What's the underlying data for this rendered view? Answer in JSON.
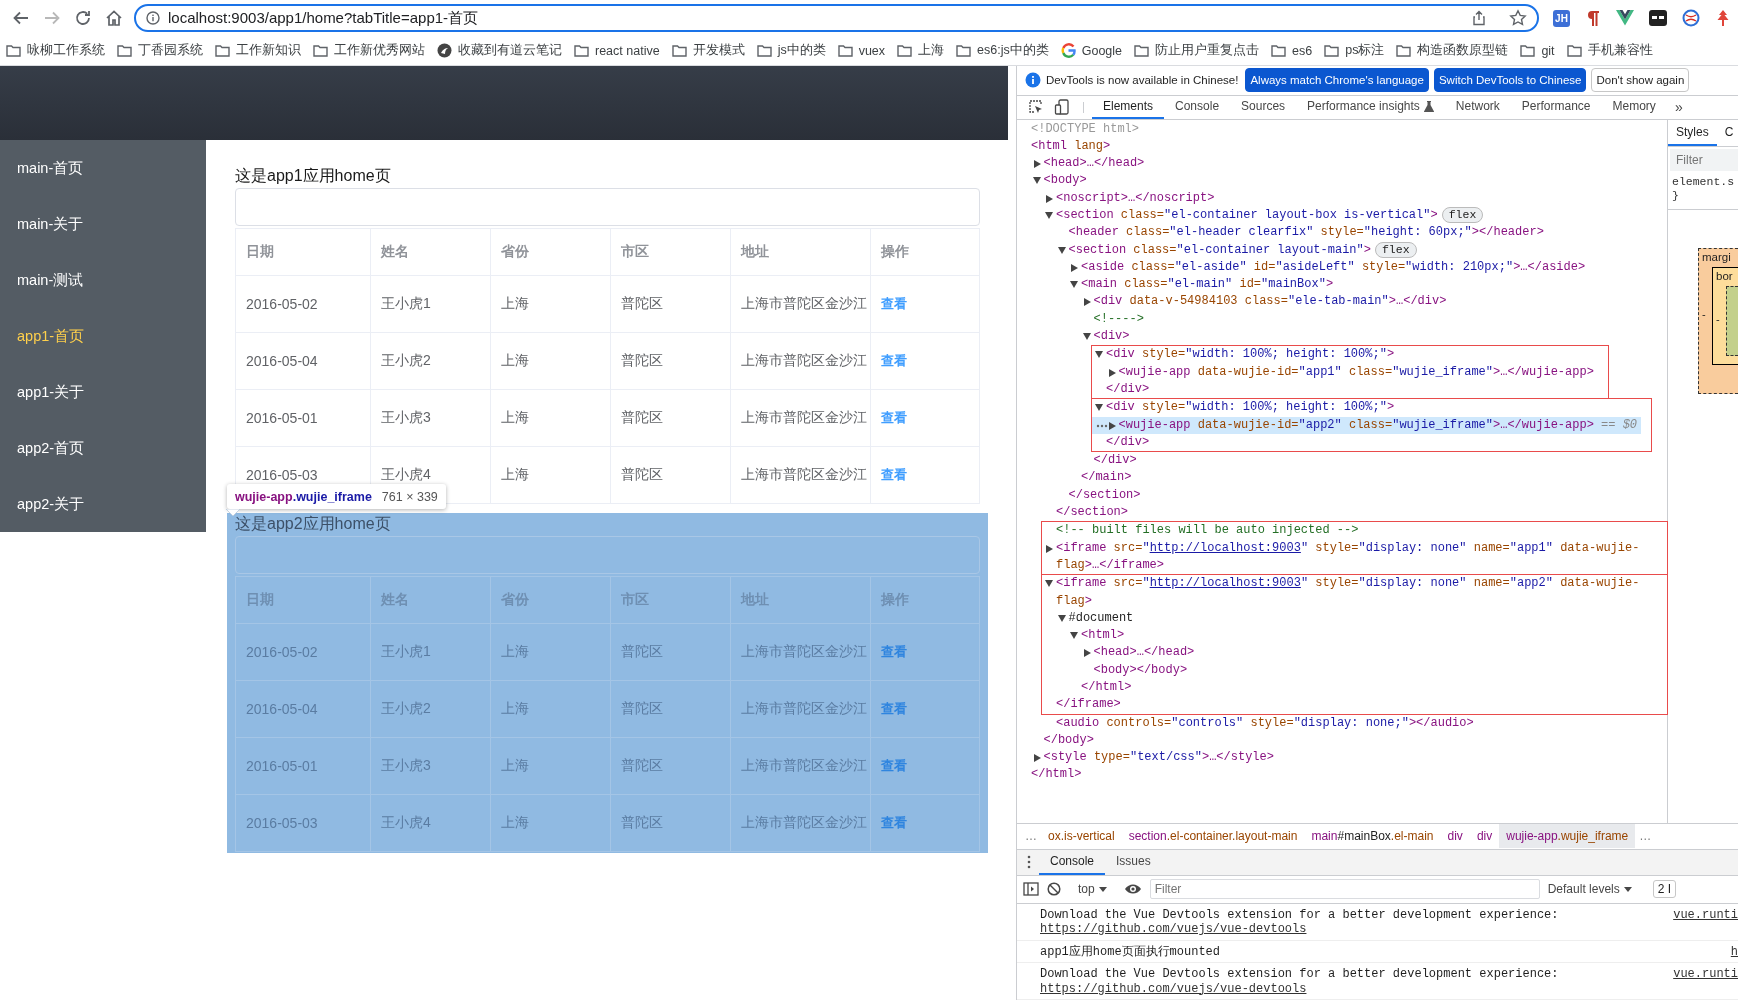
{
  "browser": {
    "nav": [
      {
        "kind": "back",
        "disabled": false
      },
      {
        "kind": "forward",
        "disabled": true
      },
      {
        "kind": "reload",
        "disabled": false
      },
      {
        "kind": "home",
        "disabled": false
      }
    ],
    "url": "localhost:9003/app1/home?tabTitle=app1-首页",
    "extensions": [
      {
        "kind": "badge",
        "text": "JH"
      },
      {
        "kind": "pilcrow"
      },
      {
        "kind": "vue"
      },
      {
        "kind": "mask"
      },
      {
        "kind": "globe"
      },
      {
        "kind": "tree"
      }
    ],
    "bookmarks": [
      {
        "kind": "folder",
        "label": "咏柳工作系统"
      },
      {
        "kind": "folder",
        "label": "丁香园系统"
      },
      {
        "kind": "folder",
        "label": "工作新知识"
      },
      {
        "kind": "folder",
        "label": "工作新优秀网站"
      },
      {
        "kind": "site",
        "label": "收藏到有道云笔记"
      },
      {
        "kind": "folder",
        "label": "react native"
      },
      {
        "kind": "folder",
        "label": "开发模式"
      },
      {
        "kind": "folder",
        "label": "js中的类"
      },
      {
        "kind": "folder",
        "label": "vuex"
      },
      {
        "kind": "folder",
        "label": "上海"
      },
      {
        "kind": "folder",
        "label": "es6:js中的类"
      },
      {
        "kind": "google",
        "label": "Google"
      },
      {
        "kind": "folder",
        "label": "防止用户重复点击"
      },
      {
        "kind": "folder",
        "label": "es6"
      },
      {
        "kind": "folder",
        "label": "ps标注"
      },
      {
        "kind": "folder",
        "label": "构造函数原型链"
      },
      {
        "kind": "folder",
        "label": "git"
      },
      {
        "kind": "folder",
        "label": "手机兼容性"
      }
    ]
  },
  "page": {
    "menu": [
      {
        "label": "main-首页",
        "selected": false
      },
      {
        "label": "main-关于",
        "selected": false
      },
      {
        "label": "main-测试",
        "selected": false
      },
      {
        "label": "app1-首页",
        "selected": true
      },
      {
        "label": "app1-关于",
        "selected": false
      },
      {
        "label": "app2-首页",
        "selected": false
      },
      {
        "label": "app2-关于",
        "selected": false
      }
    ],
    "frames": [
      {
        "title": "这是app1应用home页",
        "inspected": false,
        "columns": [
          "日期",
          "姓名",
          "省份",
          "市区",
          "地址",
          "操作"
        ],
        "rows": [
          {
            "date": "2016-05-02",
            "name": "王小虎1",
            "province": "上海",
            "city": "普陀区",
            "address": "上海市普陀区金沙江",
            "action": "查看"
          },
          {
            "date": "2016-05-04",
            "name": "王小虎2",
            "province": "上海",
            "city": "普陀区",
            "address": "上海市普陀区金沙江",
            "action": "查看"
          },
          {
            "date": "2016-05-01",
            "name": "王小虎3",
            "province": "上海",
            "city": "普陀区",
            "address": "上海市普陀区金沙江",
            "action": "查看"
          },
          {
            "date": "2016-05-03",
            "name": "王小虎4",
            "province": "上海",
            "city": "普陀区",
            "address": "上海市普陀区金沙江",
            "action": "查看"
          }
        ]
      },
      {
        "title": "这是app2应用home页",
        "inspected": true,
        "columns": [
          "日期",
          "姓名",
          "省份",
          "市区",
          "地址",
          "操作"
        ],
        "rows": [
          {
            "date": "2016-05-02",
            "name": "王小虎1",
            "province": "上海",
            "city": "普陀区",
            "address": "上海市普陀区金沙江",
            "action": "查看"
          },
          {
            "date": "2016-05-04",
            "name": "王小虎2",
            "province": "上海",
            "city": "普陀区",
            "address": "上海市普陀区金沙江",
            "action": "查看"
          },
          {
            "date": "2016-05-01",
            "name": "王小虎3",
            "province": "上海",
            "city": "普陀区",
            "address": "上海市普陀区金沙江",
            "action": "查看"
          },
          {
            "date": "2016-05-03",
            "name": "王小虎4",
            "province": "上海",
            "city": "普陀区",
            "address": "上海市普陀区金沙江",
            "action": "查看"
          }
        ]
      }
    ],
    "tooltip": {
      "tag": "wujie-app",
      "cls": ".wujie_iframe",
      "size": "761 × 339"
    }
  },
  "devtools": {
    "infobar": {
      "message": "DevTools is now available in Chinese!",
      "buttons": [
        {
          "label": "Always match Chrome's language",
          "kind": "primary"
        },
        {
          "label": "Switch DevTools to Chinese",
          "kind": "primary"
        },
        {
          "label": "Don't show again",
          "kind": "secondary"
        }
      ]
    },
    "tabs": [
      {
        "label": "Elements",
        "selected": true,
        "kind": "plain"
      },
      {
        "label": "Console",
        "selected": false,
        "kind": "plain"
      },
      {
        "label": "Sources",
        "selected": false,
        "kind": "plain"
      },
      {
        "label": "Performance insights",
        "selected": false,
        "kind": "experiment"
      },
      {
        "label": "Network",
        "selected": false,
        "kind": "plain"
      },
      {
        "label": "Performance",
        "selected": false,
        "kind": "plain"
      },
      {
        "label": "Memory",
        "selected": false,
        "kind": "plain"
      }
    ],
    "more_tabs": "»",
    "tree": [
      {
        "kind": "element",
        "selected": false,
        "line": [
          {
            "kind": "doctype",
            "text": "<!DOCTYPE html>"
          }
        ]
      },
      {
        "kind": "element",
        "selected": false,
        "line": [
          {
            "kind": "tag",
            "text": "<html"
          },
          {
            "kind": "attr",
            "text": " lang"
          },
          {
            "kind": "tag",
            "text": ">"
          }
        ],
        "close": [
          {
            "kind": "tag",
            "text": "</html>"
          }
        ],
        "children": [
          {
            "kind": "element",
            "selected": false,
            "expanded": false,
            "line": [
              {
                "kind": "tag",
                "text": "<head>…</head>"
              }
            ]
          },
          {
            "kind": "element",
            "selected": false,
            "expanded": true,
            "line": [
              {
                "kind": "tag",
                "text": "<body>"
              }
            ],
            "close": [
              {
                "kind": "tag",
                "text": "</body>"
              }
            ],
            "children": [
              {
                "kind": "element",
                "selected": false,
                "expanded": false,
                "line": [
                  {
                    "kind": "tag",
                    "text": "<noscript>…</noscript>"
                  }
                ]
              },
              {
                "kind": "element",
                "selected": false,
                "expanded": true,
                "line": [
                  {
                    "kind": "tag",
                    "text": "<section"
                  },
                  {
                    "kind": "attr",
                    "text": " class="
                  },
                  {
                    "kind": "value",
                    "text": "\"el-container layout-box is-vertical\""
                  },
                  {
                    "kind": "tag",
                    "text": ">"
                  },
                  {
                    "kind": "badge",
                    "text": "flex"
                  }
                ],
                "close": [
                  {
                    "kind": "tag",
                    "text": "</section>"
                  }
                ],
                "children": [
                  {
                    "kind": "element",
                    "selected": false,
                    "line": [
                      {
                        "kind": "tag",
                        "text": "<header"
                      },
                      {
                        "kind": "attr",
                        "text": " class="
                      },
                      {
                        "kind": "value",
                        "text": "\"el-header clearfix\""
                      },
                      {
                        "kind": "attr",
                        "text": " style="
                      },
                      {
                        "kind": "value",
                        "text": "\"height: 60px;\""
                      },
                      {
                        "kind": "tag",
                        "text": "></header>"
                      }
                    ]
                  },
                  {
                    "kind": "element",
                    "selected": false,
                    "expanded": true,
                    "line": [
                      {
                        "kind": "tag",
                        "text": "<section"
                      },
                      {
                        "kind": "attr",
                        "text": " class="
                      },
                      {
                        "kind": "value",
                        "text": "\"el-container layout-main\""
                      },
                      {
                        "kind": "tag",
                        "text": ">"
                      },
                      {
                        "kind": "badge",
                        "text": "flex"
                      }
                    ],
                    "close": [
                      {
                        "kind": "tag",
                        "text": "</section>"
                      }
                    ],
                    "children": [
                      {
                        "kind": "element",
                        "selected": false,
                        "expanded": false,
                        "line": [
                          {
                            "kind": "tag",
                            "text": "<aside"
                          },
                          {
                            "kind": "attr",
                            "text": " class="
                          },
                          {
                            "kind": "value",
                            "text": "\"el-aside\""
                          },
                          {
                            "kind": "attr",
                            "text": " id="
                          },
                          {
                            "kind": "value",
                            "text": "\"asideLeft\""
                          },
                          {
                            "kind": "attr",
                            "text": " style="
                          },
                          {
                            "kind": "value",
                            "text": "\"width: 210px;\""
                          },
                          {
                            "kind": "tag",
                            "text": ">…</aside>"
                          }
                        ]
                      },
                      {
                        "kind": "element",
                        "selected": false,
                        "expanded": true,
                        "line": [
                          {
                            "kind": "tag",
                            "text": "<main"
                          },
                          {
                            "kind": "attr",
                            "text": " class="
                          },
                          {
                            "kind": "value",
                            "text": "\"el-main\""
                          },
                          {
                            "kind": "attr",
                            "text": " id="
                          },
                          {
                            "kind": "value",
                            "text": "\"mainBox\""
                          },
                          {
                            "kind": "tag",
                            "text": ">"
                          }
                        ],
                        "close": [
                          {
                            "kind": "tag",
                            "text": "</main>"
                          }
                        ],
                        "children": [
                          {
                            "kind": "element",
                            "selected": false,
                            "expanded": false,
                            "line": [
                              {
                                "kind": "tag",
                                "text": "<div"
                              },
                              {
                                "kind": "attr",
                                "text": " data-v-54984103 class="
                              },
                              {
                                "kind": "value",
                                "text": "\"ele-tab-main\""
                              },
                              {
                                "kind": "tag",
                                "text": ">…</div>"
                              }
                            ]
                          },
                          {
                            "kind": "element",
                            "selected": false,
                            "line": [
                              {
                                "kind": "comment",
                                "text": "<!---->"
                              }
                            ]
                          },
                          {
                            "kind": "element",
                            "selected": false,
                            "expanded": true,
                            "line": [
                              {
                                "kind": "tag",
                                "text": "<div>"
                              }
                            ],
                            "close": [
                              {
                                "kind": "tag",
                                "text": "</div>"
                              }
                            ],
                            "children": [
                              {
                                "kind": "box",
                                "children": [
                                  {
                                    "kind": "element",
                                    "selected": false,
                                    "expanded": true,
                                    "line": [
                                      {
                                        "kind": "tag",
                                        "text": "<div"
                                      },
                                      {
                                        "kind": "attr",
                                        "text": " style="
                                      },
                                      {
                                        "kind": "value",
                                        "text": "\"width: 100%; height: 100%;\""
                                      },
                                      {
                                        "kind": "tag",
                                        "text": ">"
                                      }
                                    ],
                                    "close": [
                                      {
                                        "kind": "tag",
                                        "text": "</div>"
                                      }
                                    ],
                                    "children": [
                                      {
                                        "kind": "element",
                                        "selected": false,
                                        "expanded": false,
                                        "line": [
                                          {
                                            "kind": "tag",
                                            "text": "<wujie-app"
                                          },
                                          {
                                            "kind": "attr",
                                            "text": " data-wujie-id="
                                          },
                                          {
                                            "kind": "value",
                                            "text": "\"app1\""
                                          },
                                          {
                                            "kind": "attr",
                                            "text": " class="
                                          },
                                          {
                                            "kind": "value",
                                            "text": "\"wujie_iframe\""
                                          },
                                          {
                                            "kind": "tag",
                                            "text": ">…</wujie-app>"
                                          }
                                        ]
                                      }
                                    ]
                                  }
                                ]
                              },
                              {
                                "kind": "box",
                                "children": [
                                  {
                                    "kind": "element",
                                    "selected": false,
                                    "expanded": true,
                                    "line": [
                                      {
                                        "kind": "tag",
                                        "text": "<div"
                                      },
                                      {
                                        "kind": "attr",
                                        "text": " style="
                                      },
                                      {
                                        "kind": "value",
                                        "text": "\"width: 100%; height: 100%;\""
                                      },
                                      {
                                        "kind": "tag",
                                        "text": ">"
                                      }
                                    ],
                                    "close": [
                                      {
                                        "kind": "tag",
                                        "text": "</div>"
                                      }
                                    ],
                                    "children": [
                                      {
                                        "kind": "element",
                                        "selected": true,
                                        "expanded": false,
                                        "line": [
                                          {
                                            "kind": "tag",
                                            "text": "<wujie-app"
                                          },
                                          {
                                            "kind": "attr",
                                            "text": " data-wujie-id="
                                          },
                                          {
                                            "kind": "value",
                                            "text": "\"app2\""
                                          },
                                          {
                                            "kind": "attr",
                                            "text": " class="
                                          },
                                          {
                                            "kind": "value",
                                            "text": "\"wujie_iframe\""
                                          },
                                          {
                                            "kind": "tag",
                                            "text": ">…</wujie-app>"
                                          },
                                          {
                                            "kind": "ref",
                                            "text": " == $0"
                                          }
                                        ]
                                      }
                                    ]
                                  }
                                ]
                              }
                            ]
                          }
                        ]
                      }
                    ]
                  }
                ]
              },
              {
                "kind": "box",
                "children": [
                  {
                    "kind": "element",
                    "selected": false,
                    "line": [
                      {
                        "kind": "comment",
                        "text": "<!-- built files will be auto injected -->"
                      }
                    ]
                  },
                  {
                    "kind": "element",
                    "selected": false,
                    "expanded": false,
                    "line": [
                      {
                        "kind": "tag",
                        "text": "<iframe"
                      },
                      {
                        "kind": "attr",
                        "text": " src="
                      },
                      {
                        "kind": "value",
                        "text": "\""
                      },
                      {
                        "kind": "link",
                        "text": "http://localhost:9003"
                      },
                      {
                        "kind": "value",
                        "text": "\""
                      },
                      {
                        "kind": "attr",
                        "text": " style="
                      },
                      {
                        "kind": "value",
                        "text": "\"display: none\""
                      },
                      {
                        "kind": "attr",
                        "text": " name="
                      },
                      {
                        "kind": "value",
                        "text": "\"app1\""
                      },
                      {
                        "kind": "attr",
                        "text": " data-wujie-flag"
                      },
                      {
                        "kind": "tag",
                        "text": ">…</iframe>"
                      }
                    ]
                  }
                ]
              },
              {
                "kind": "box",
                "children": [
                  {
                    "kind": "element",
                    "selected": false,
                    "expanded": true,
                    "line": [
                      {
                        "kind": "tag",
                        "text": "<iframe"
                      },
                      {
                        "kind": "attr",
                        "text": " src="
                      },
                      {
                        "kind": "value",
                        "text": "\""
                      },
                      {
                        "kind": "link",
                        "text": "http://localhost:9003"
                      },
                      {
                        "kind": "value",
                        "text": "\""
                      },
                      {
                        "kind": "attr",
                        "text": " style="
                      },
                      {
                        "kind": "value",
                        "text": "\"display: none\""
                      },
                      {
                        "kind": "attr",
                        "text": " name="
                      },
                      {
                        "kind": "value",
                        "text": "\"app2\""
                      },
                      {
                        "kind": "attr",
                        "text": " data-wujie-flag"
                      },
                      {
                        "kind": "tag",
                        "text": ">"
                      }
                    ],
                    "close": [
                      {
                        "kind": "tag",
                        "text": "</iframe>"
                      }
                    ],
                    "children": [
                      {
                        "kind": "element",
                        "selected": false,
                        "expanded": true,
                        "line": [
                          {
                            "kind": "plain",
                            "text": "#document"
                          }
                        ],
                        "children": [
                          {
                            "kind": "element",
                            "selected": false,
                            "expanded": true,
                            "line": [
                              {
                                "kind": "tag",
                                "text": "<html>"
                              }
                            ],
                            "close": [
                              {
                                "kind": "tag",
                                "text": "</html>"
                              }
                            ],
                            "children": [
                              {
                                "kind": "element",
                                "selected": false,
                                "expanded": false,
                                "line": [
                                  {
                                    "kind": "tag",
                                    "text": "<head>…</head>"
                                  }
                                ]
                              },
                              {
                                "kind": "element",
                                "selected": false,
                                "line": [
                                  {
                                    "kind": "tag",
                                    "text": "<body></body>"
                                  }
                                ]
                              }
                            ]
                          }
                        ]
                      }
                    ]
                  }
                ]
              },
              {
                "kind": "element",
                "selected": false,
                "line": [
                  {
                    "kind": "tag",
                    "text": "<audio"
                  },
                  {
                    "kind": "attr",
                    "text": " controls="
                  },
                  {
                    "kind": "value",
                    "text": "\"controls\""
                  },
                  {
                    "kind": "attr",
                    "text": " style="
                  },
                  {
                    "kind": "value",
                    "text": "\"display: none;\""
                  },
                  {
                    "kind": "tag",
                    "text": "></audio>"
                  }
                ]
              }
            ]
          },
          {
            "kind": "element",
            "selected": false,
            "expanded": false,
            "line": [
              {
                "kind": "tag",
                "text": "<style"
              },
              {
                "kind": "attr",
                "text": " type="
              },
              {
                "kind": "value",
                "text": "\"text/css\""
              },
              {
                "kind": "tag",
                "text": ">…</style>"
              }
            ]
          }
        ]
      }
    ],
    "styles_pane": {
      "tabs": [
        {
          "label": "Styles",
          "selected": true
        },
        {
          "label": "C",
          "selected": false
        }
      ],
      "filter_placeholder": "Filter",
      "rule": [
        "element.s",
        "}"
      ],
      "box_model": {
        "margin_label": "margi",
        "border_label": "bor",
        "marks": [
          "-",
          "-"
        ]
      }
    },
    "breadcrumbs": {
      "more_left": "…",
      "more_right": "…",
      "crumbs": [
        {
          "selected": false,
          "parts": [
            {
              "kind": "cls",
              "text": "ox.is-vertical"
            }
          ]
        },
        {
          "selected": false,
          "parts": [
            {
              "kind": "tag",
              "text": "section"
            },
            {
              "kind": "cls",
              "text": ".el-container.layout-main"
            }
          ]
        },
        {
          "selected": false,
          "parts": [
            {
              "kind": "tag",
              "text": "main"
            },
            {
              "kind": "id",
              "text": "#mainBox"
            },
            {
              "kind": "cls",
              "text": ".el-main"
            }
          ]
        },
        {
          "selected": false,
          "parts": [
            {
              "kind": "tag",
              "text": "div"
            }
          ]
        },
        {
          "selected": false,
          "parts": [
            {
              "kind": "tag",
              "text": "div"
            }
          ]
        },
        {
          "selected": true,
          "parts": [
            {
              "kind": "tag",
              "text": "wujie-app"
            },
            {
              "kind": "cls",
              "text": ".wujie_iframe"
            }
          ]
        }
      ]
    },
    "drawer": {
      "tabs": [
        {
          "label": "Console",
          "selected": true
        },
        {
          "label": "Issues",
          "selected": false
        }
      ],
      "context": "top",
      "filter_placeholder": "Filter",
      "levels": "Default levels",
      "issues": "2 I",
      "messages": [
        {
          "text": "Download the Vue Devtools extension for a better development experience:",
          "link": "https://github.com/vuejs/vue-devtools",
          "source": "vue.runti"
        },
        {
          "text": "app1应用home页面执行mounted",
          "source": "h"
        },
        {
          "text": "Download the Vue Devtools extension for a better development experience:",
          "link": "https://github.com/vuejs/vue-devtools",
          "source": "vue.runti"
        }
      ]
    }
  }
}
